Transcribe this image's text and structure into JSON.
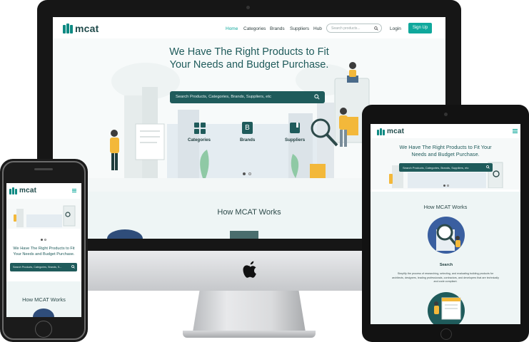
{
  "brand": {
    "name": "mcat",
    "color": "#10a89c",
    "dark": "#1f5b5b"
  },
  "desktop": {
    "nav": {
      "links": [
        "Home",
        "Categories",
        "Brands",
        "Suppliers",
        "Hub"
      ],
      "search_placeholder": "Search products...",
      "login": "Login",
      "signup": "Sign Up"
    },
    "hero": {
      "title_line1": "We Have The Right Products to Fit",
      "title_line2": "Your Needs and Budget Purchase.",
      "search_placeholder": "Search Products, Categories, Brands, Suppliers, etc",
      "icons": [
        {
          "label": "Categories",
          "icon": "grid-icon"
        },
        {
          "label": "Brands",
          "icon": "brand-b-icon",
          "glyph": "B"
        },
        {
          "label": "Suppliers",
          "icon": "book-icon"
        }
      ]
    },
    "how_title": "How MCAT Works"
  },
  "tablet": {
    "hero_title_line1": "We Have The Right Products to Fit Your",
    "hero_title_line2": "Needs and Budget Purchase.",
    "search_placeholder": "Search Products, Categories, Brands, Suppliers, etc",
    "how_title": "How MCAT Works",
    "step_title": "Search",
    "step_text_line1": "Simplify the process of researching, selecting, and evaluating building products for",
    "step_text_line2": "architects, designers, leading professionals, contractors, and developers that are technically",
    "step_text_line3": "and code compliant."
  },
  "phone": {
    "hero_title_line1": "We Have The Right Products to Fit",
    "hero_title_line2": "Your Needs and Budget Purchase.",
    "search_placeholder": "Search Products, Categories, Brands, S...",
    "how_title": "How MCAT Works"
  }
}
